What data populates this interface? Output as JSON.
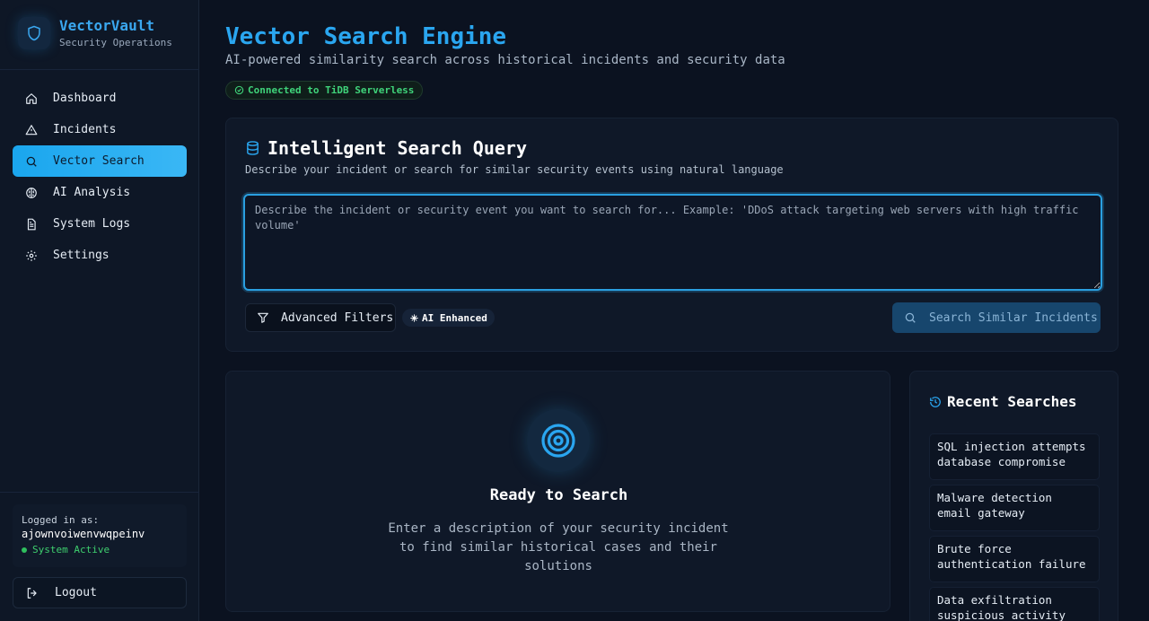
{
  "brand": {
    "name": "VectorVault",
    "subtitle": "Security Operations"
  },
  "nav": {
    "items": [
      {
        "label": "Dashboard",
        "icon": "home-icon",
        "active": false
      },
      {
        "label": "Incidents",
        "icon": "alert-triangle-icon",
        "active": false
      },
      {
        "label": "Vector Search",
        "icon": "search-icon",
        "active": true
      },
      {
        "label": "AI Analysis",
        "icon": "brain-icon",
        "active": false
      },
      {
        "label": "System Logs",
        "icon": "file-text-icon",
        "active": false
      },
      {
        "label": "Settings",
        "icon": "gear-icon",
        "active": false
      }
    ]
  },
  "user": {
    "label": "Logged in as:",
    "name": "ajownvoiwenvwqpeinv",
    "status": "System Active"
  },
  "logout": {
    "label": "Logout"
  },
  "page": {
    "title": "Vector Search Engine",
    "subtitle": "AI-powered similarity search across historical incidents and security data",
    "connection": "Connected to TiDB Serverless"
  },
  "query_panel": {
    "title": "Intelligent Search Query",
    "description": "Describe your incident or search for similar security events using natural language",
    "placeholder": "Describe the incident or security event you want to search for... Example: 'DDoS attack targeting web servers with high traffic volume'",
    "value": "",
    "filters_label": "Advanced Filters",
    "ai_badge": "AI Enhanced",
    "search_label": "Search Similar Incidents"
  },
  "ready": {
    "title": "Ready to Search",
    "description": "Enter a description of your security incident to find similar historical cases and their solutions"
  },
  "recent": {
    "title": "Recent Searches",
    "items": [
      "SQL injection attempts database compromise",
      "Malware detection email gateway",
      "Brute force authentication failure",
      "Data exfiltration suspicious activity"
    ]
  },
  "colors": {
    "accent": "#2aa6f0",
    "success": "#3fd37a",
    "background": "#0b1220"
  }
}
